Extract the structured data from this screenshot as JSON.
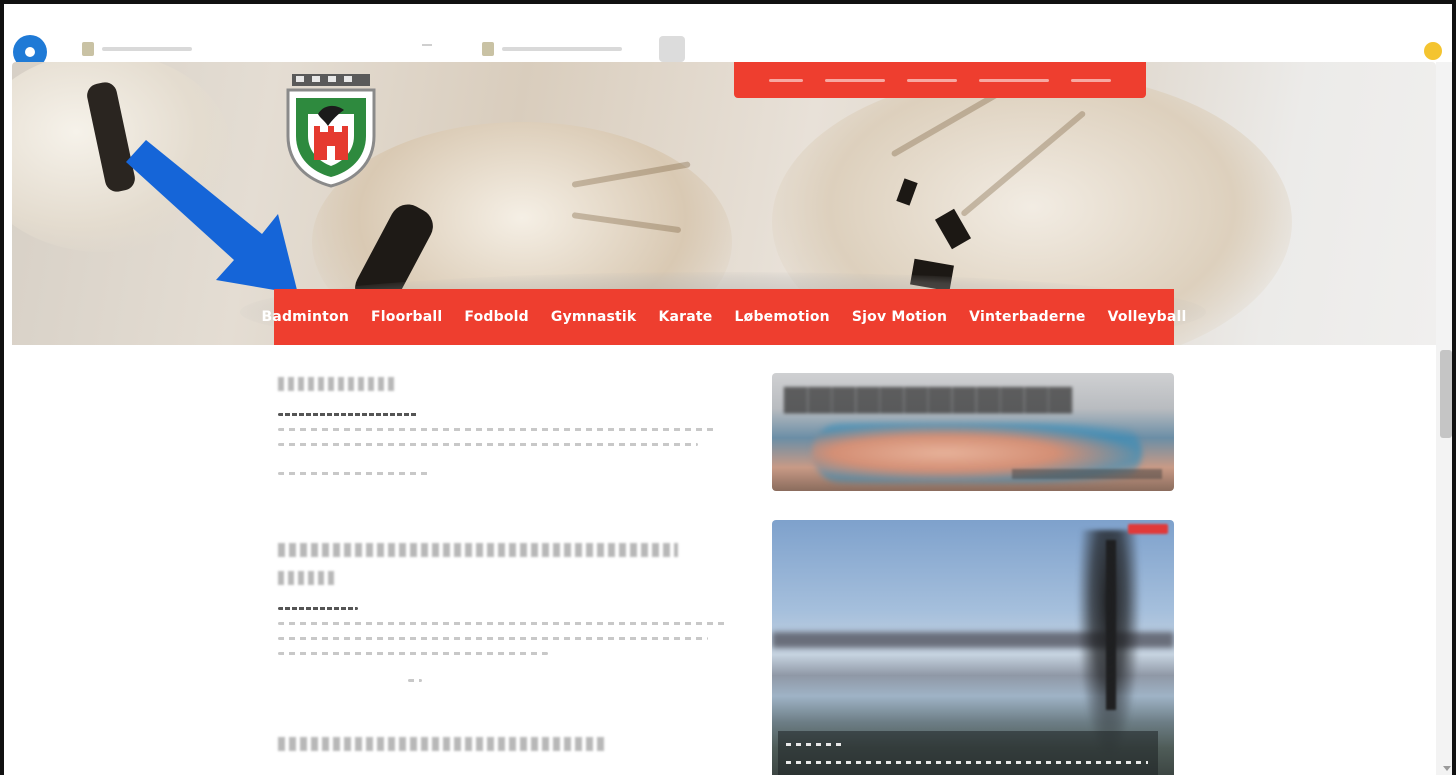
{
  "nav": {
    "items": [
      {
        "label": "Badminton"
      },
      {
        "label": "Floorball"
      },
      {
        "label": "Fodbold"
      },
      {
        "label": "Gymnastik"
      },
      {
        "label": "Karate"
      },
      {
        "label": "Løbemotion"
      },
      {
        "label": "Sjov Motion"
      },
      {
        "label": "Vinterbaderne"
      },
      {
        "label": "Volleyball"
      }
    ]
  },
  "colors": {
    "nav_red": "#ee3e2f",
    "annotation_arrow": "#1565d8",
    "browser_logo": "#1f7ad6"
  },
  "icons": {
    "browser": "browser-logo-icon",
    "club_logo": "club-shield-icon",
    "annotation": "arrow-pointer-icon"
  }
}
